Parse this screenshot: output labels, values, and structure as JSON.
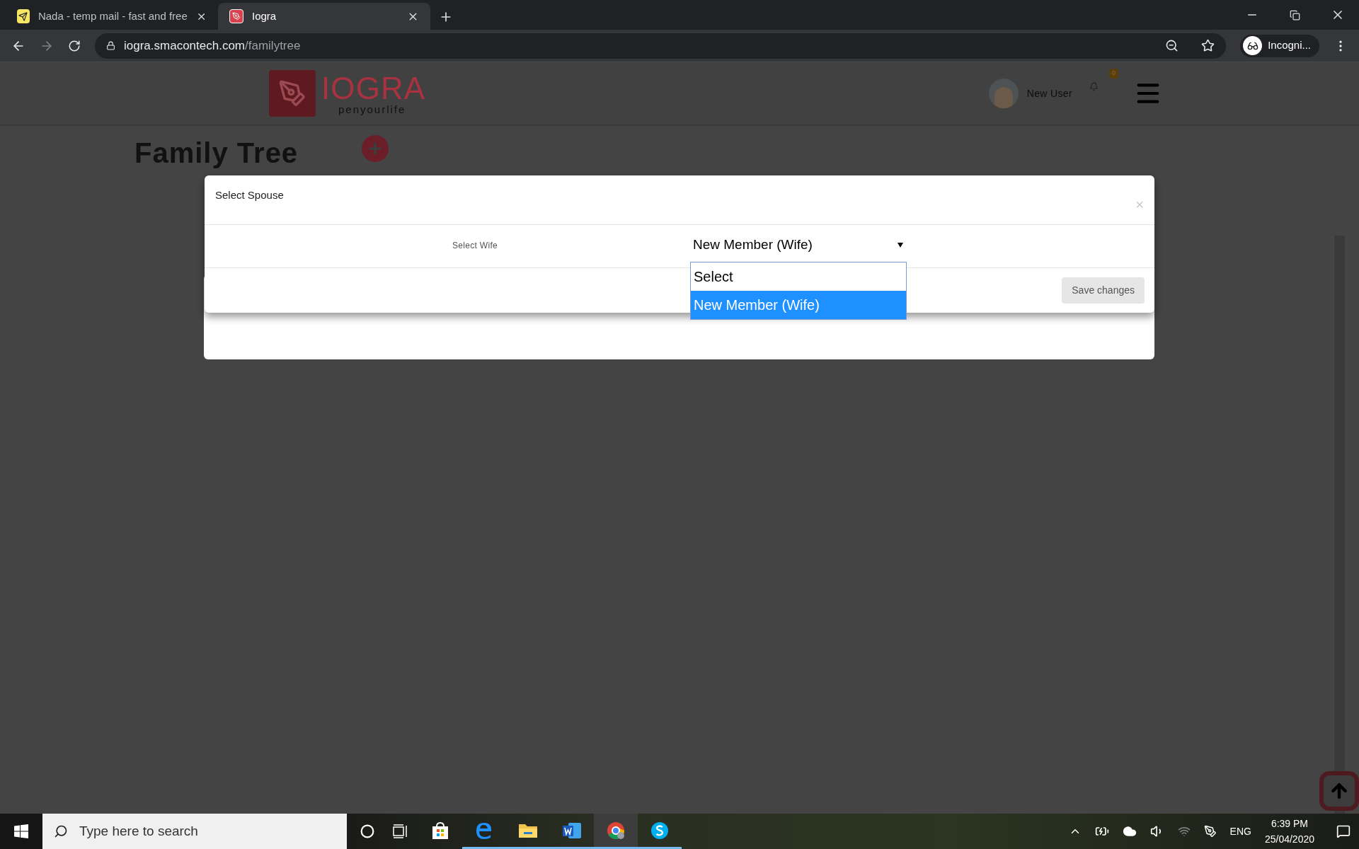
{
  "browser": {
    "tabs": [
      {
        "title": "Nada - temp mail - fast and free",
        "kind": "mail",
        "selected": false
      },
      {
        "title": "Iogra",
        "kind": "site",
        "selected": true
      }
    ],
    "address": {
      "host": "iogra.smacontech.com",
      "path": "/familytree"
    },
    "profile": "Incogni..."
  },
  "header": {
    "logo_name": "IOGRA",
    "logo_tagline": "penyourlife",
    "user_name": "New User",
    "notification_count": "0"
  },
  "page_title": "Family Tree",
  "modal": {
    "title": "Select Spouse",
    "close": "×",
    "field_label": "Select Wife",
    "select_value": "New Member (Wife)",
    "options": [
      {
        "label": "Select",
        "selected": false
      },
      {
        "label": "New Member (Wife)",
        "selected": true
      }
    ],
    "save_button": "Save changes"
  },
  "taskbar": {
    "search_placeholder": "Type here to search",
    "apps": [
      {
        "kind": "store",
        "running": false,
        "selected": false
      },
      {
        "kind": "edge",
        "running": true,
        "selected": false
      },
      {
        "kind": "explorer",
        "running": true,
        "selected": false
      },
      {
        "kind": "word",
        "running": true,
        "selected": false
      },
      {
        "kind": "chrome",
        "running": true,
        "selected": true
      },
      {
        "kind": "skype",
        "running": true,
        "selected": false
      }
    ],
    "language": "ENG",
    "time": "6:39 PM",
    "date": "25/04/2020"
  }
}
